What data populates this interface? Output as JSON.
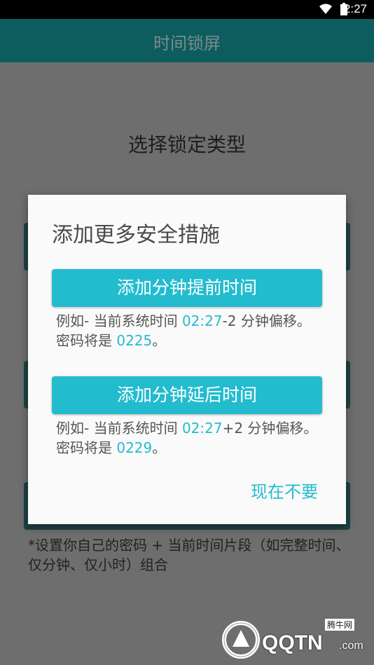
{
  "status_bar": {
    "time": "2:27"
  },
  "app_bar": {
    "title": "时间锁屏"
  },
  "page": {
    "heading": "选择锁定类型",
    "note": "*设置你自己的密码 + 当前时间片段（如完整时间、仅分钟、仅小时）组合"
  },
  "dialog": {
    "title": "添加更多安全措施",
    "advance_button": "添加分钟提前时间",
    "advance_example": {
      "prefix": "例如- 当前系统时间 ",
      "time": "02:27",
      "offset": "-2 分钟偏移。密码将是 ",
      "password": "0225",
      "suffix": "。"
    },
    "delay_button": "添加分钟延后时间",
    "delay_example": {
      "prefix": "例如- 当前系统时间 ",
      "time": "02:27",
      "offset": "+2 分钟偏移。密码将是 ",
      "password": "0229",
      "suffix": "。"
    },
    "dismiss_button": "现在不要"
  },
  "watermark": {
    "brand": "QQTN",
    "domain": ".com",
    "label": "腾牛网"
  },
  "colors": {
    "accent": "#23bccf",
    "app_bar": "#0d5c5e",
    "overlay": "#6e6e6e"
  },
  "icons": [
    "wifi-icon",
    "battery-icon",
    "watermark-logo-icon"
  ]
}
